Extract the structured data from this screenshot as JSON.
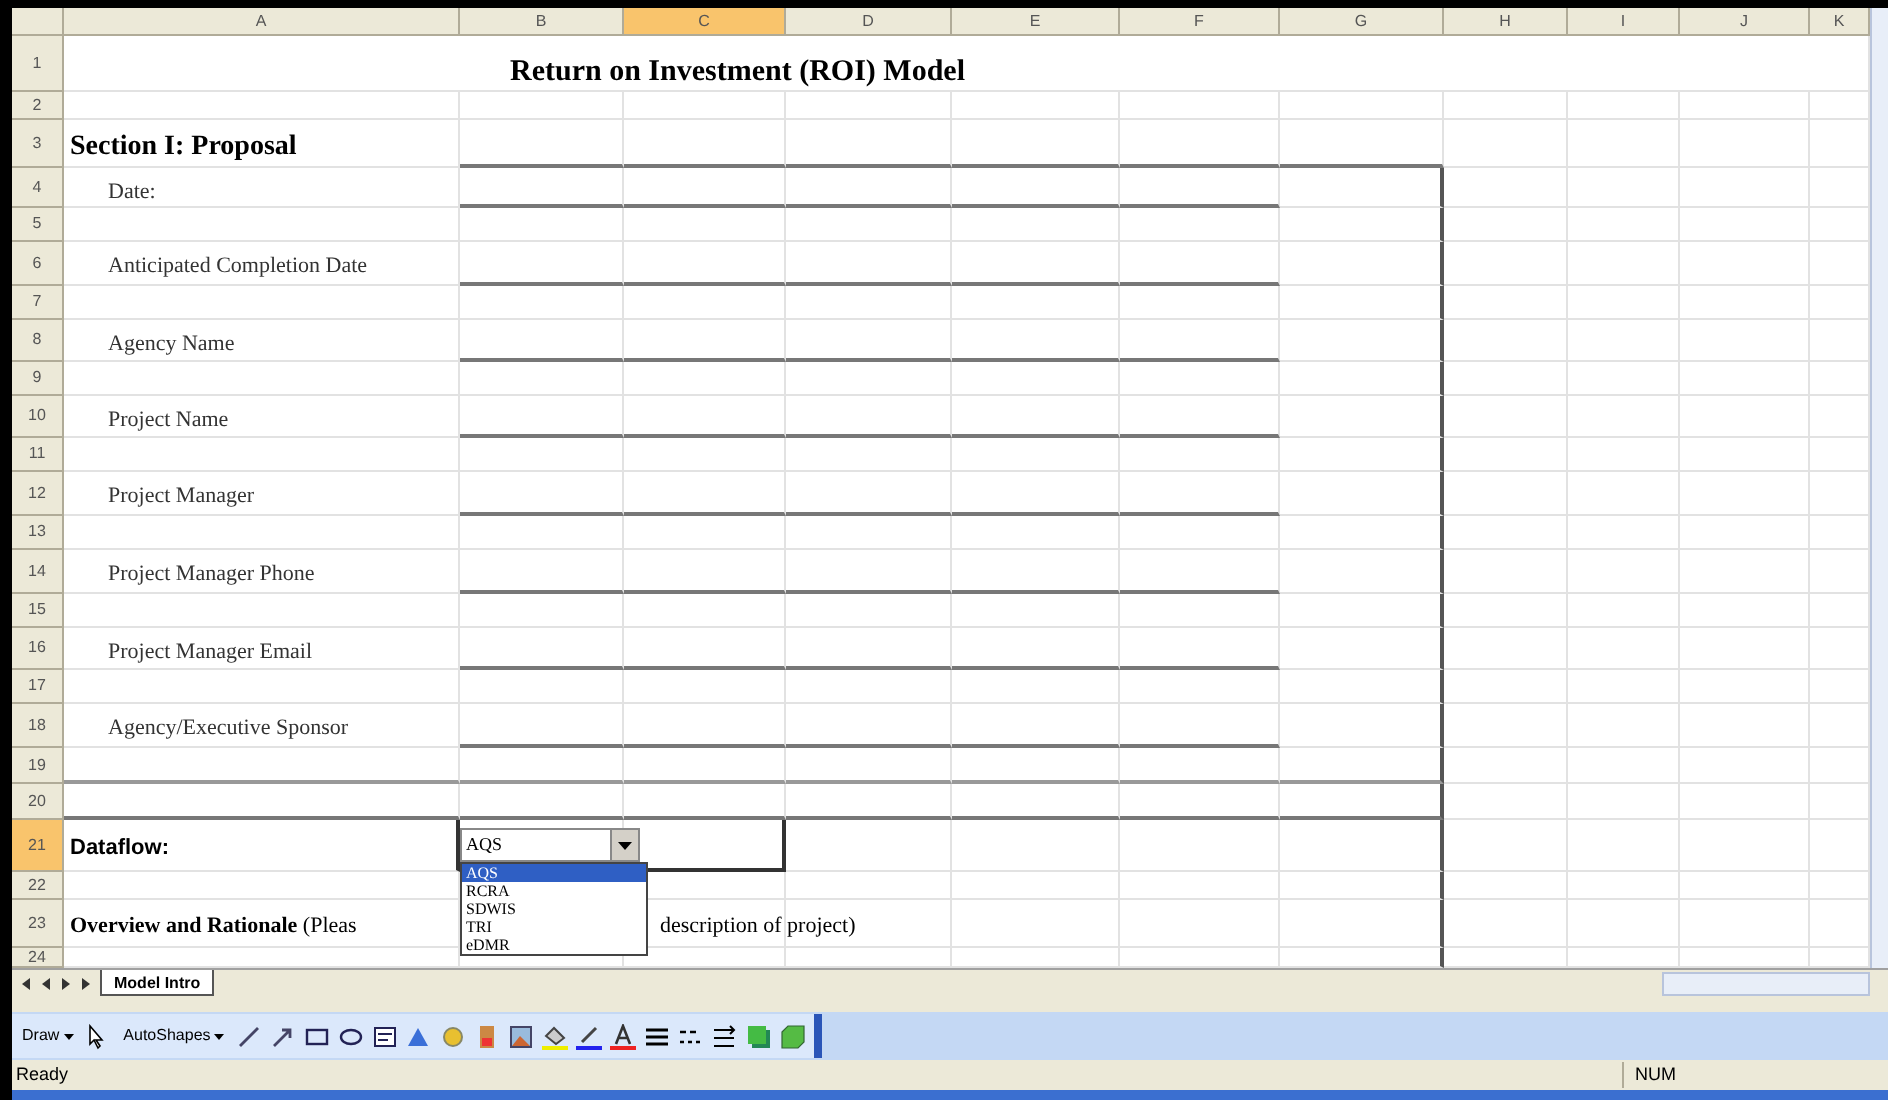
{
  "columns": [
    {
      "label": "A",
      "selected": false
    },
    {
      "label": "B",
      "selected": false
    },
    {
      "label": "C",
      "selected": true
    },
    {
      "label": "D",
      "selected": false
    },
    {
      "label": "E",
      "selected": false
    },
    {
      "label": "F",
      "selected": false
    },
    {
      "label": "G",
      "selected": false
    },
    {
      "label": "H",
      "selected": false
    },
    {
      "label": "I",
      "selected": false
    },
    {
      "label": "J",
      "selected": false
    },
    {
      "label": "K",
      "selected": false
    }
  ],
  "rows": [
    {
      "number": "1",
      "kind": "title",
      "text": "Return on Investment (ROI) Model",
      "selected": false
    },
    {
      "number": "2",
      "kind": "blank",
      "selected": false
    },
    {
      "number": "3",
      "kind": "section",
      "text": "Section I:  Proposal",
      "selected": false
    },
    {
      "number": "4",
      "kind": "field",
      "text": "Date:",
      "selected": false
    },
    {
      "number": "5",
      "kind": "blank",
      "selected": false
    },
    {
      "number": "6",
      "kind": "field",
      "text": "Anticipated Completion Date",
      "selected": false
    },
    {
      "number": "7",
      "kind": "blank",
      "selected": false
    },
    {
      "number": "8",
      "kind": "field",
      "text": "Agency Name",
      "selected": false
    },
    {
      "number": "9",
      "kind": "blank",
      "selected": false
    },
    {
      "number": "10",
      "kind": "field",
      "text": "Project Name",
      "selected": false
    },
    {
      "number": "11",
      "kind": "blank",
      "selected": false
    },
    {
      "number": "12",
      "kind": "field",
      "text": "Project Manager",
      "selected": false
    },
    {
      "number": "13",
      "kind": "blank",
      "selected": false
    },
    {
      "number": "14",
      "kind": "field",
      "text": "Project Manager Phone",
      "selected": false
    },
    {
      "number": "15",
      "kind": "blank",
      "selected": false
    },
    {
      "number": "16",
      "kind": "field",
      "text": "Project Manager Email",
      "selected": false
    },
    {
      "number": "17",
      "kind": "blank",
      "selected": false
    },
    {
      "number": "18",
      "kind": "field",
      "text": "Agency/Executive Sponsor",
      "selected": false
    },
    {
      "number": "19",
      "kind": "blank",
      "selected": false
    },
    {
      "number": "20",
      "kind": "blank",
      "selected": false
    },
    {
      "number": "21",
      "kind": "dataflow",
      "text": "Dataflow:",
      "value": "AQS",
      "selected": true
    },
    {
      "number": "22",
      "kind": "blank",
      "selected": false
    },
    {
      "number": "23",
      "kind": "overview",
      "text": "Overview and Rationale",
      "note_start": "(Pleas",
      "note_end": "description of project)",
      "selected": false
    },
    {
      "number": "24",
      "kind": "blank",
      "selected": false
    }
  ],
  "dropdown": {
    "options": [
      {
        "label": "AQS",
        "selected": true
      },
      {
        "label": "RCRA",
        "selected": false
      },
      {
        "label": "SDWIS",
        "selected": false
      },
      {
        "label": "TRI",
        "selected": false
      },
      {
        "label": "eDMR",
        "selected": false
      }
    ]
  },
  "sheet_tabs": [
    {
      "label": "Model Intro",
      "selected": true
    }
  ],
  "drawing_toolbar": {
    "draw_menu": "Draw",
    "autoshapes_menu": "AutoShapes"
  },
  "status_bar": {
    "status": "Ready",
    "indicator": "NUM"
  }
}
